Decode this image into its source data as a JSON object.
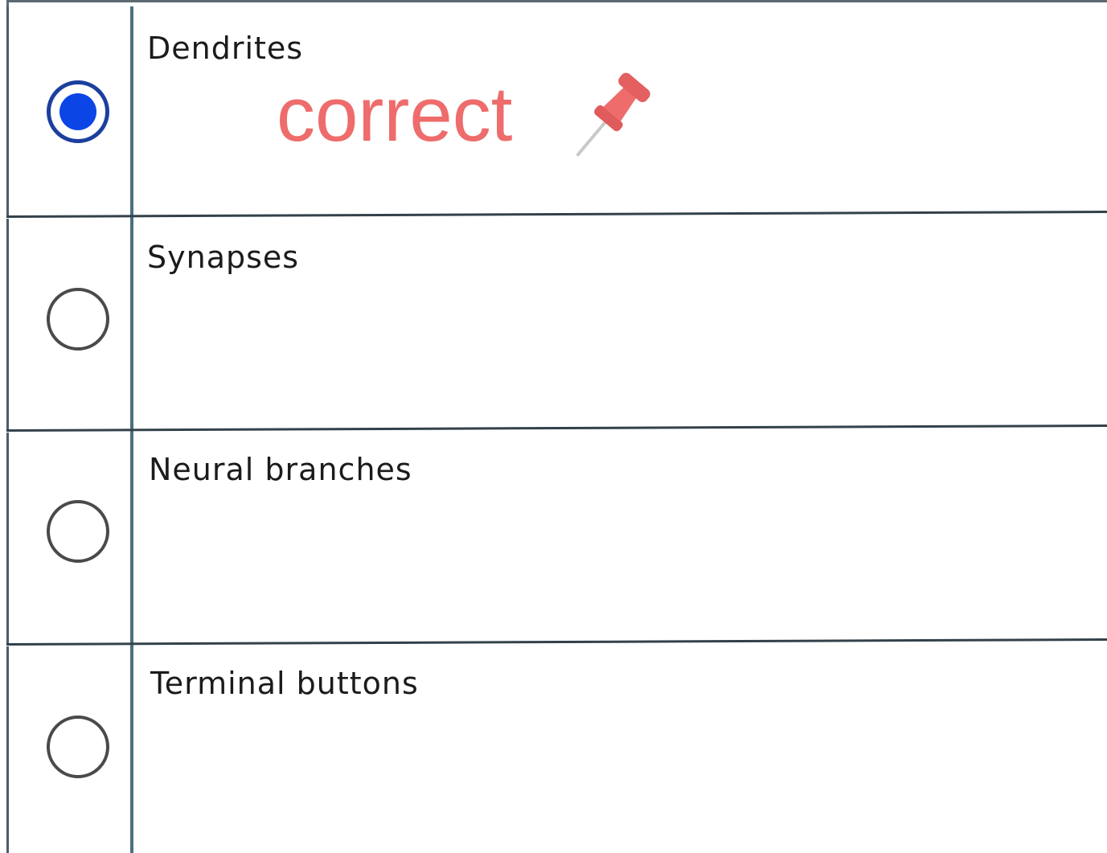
{
  "options": [
    {
      "label": "Dendrites",
      "selected": true
    },
    {
      "label": "Synapses",
      "selected": false
    },
    {
      "label": "Neural branches",
      "selected": false
    },
    {
      "label": "Terminal buttons",
      "selected": false
    }
  ],
  "annotation": {
    "text": "correct",
    "color": "#ee6c6c",
    "icon": "pushpin-icon"
  },
  "colors": {
    "radio_selected": "#0b45e6",
    "radio_ring_selected": "#1c3f9e",
    "border": "#33414a"
  }
}
